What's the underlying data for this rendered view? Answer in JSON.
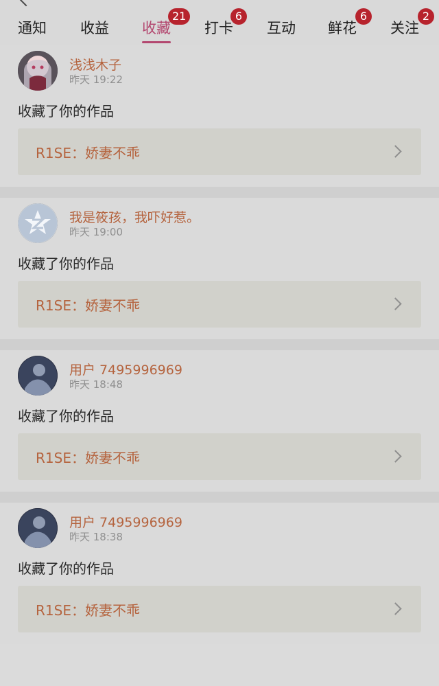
{
  "tabs": [
    {
      "label": "通知",
      "badge": ""
    },
    {
      "label": "收益",
      "badge": ""
    },
    {
      "label": "收藏",
      "badge": "21",
      "active": true
    },
    {
      "label": "打卡",
      "badge": "6"
    },
    {
      "label": "互动",
      "badge": ""
    },
    {
      "label": "鲜花",
      "badge": "6"
    },
    {
      "label": "关注",
      "badge": "2"
    }
  ],
  "feed": [
    {
      "username": "浅浅木子",
      "time": "昨天 19:22",
      "message": "收藏了你的作品",
      "work_title": "R1SE：娇妻不乖",
      "avatar_icon": "anime-girl-avatar"
    },
    {
      "username": "我是筱孩，我吓好惹。",
      "time": "昨天 19:00",
      "message": "收藏了你的作品",
      "work_title": "R1SE：娇妻不乖",
      "avatar_icon": "default-star-avatar"
    },
    {
      "username": "用户 7495996969",
      "time": "昨天 18:48",
      "message": "收藏了你的作品",
      "work_title": "R1SE：娇妻不乖",
      "avatar_icon": "blue-photo-avatar"
    },
    {
      "username": "用户 7495996969",
      "time": "昨天 18:38",
      "message": "收藏了你的作品",
      "work_title": "R1SE：娇妻不乖",
      "avatar_icon": "blue-photo-avatar"
    }
  ],
  "colors": {
    "accent": "#b3476f",
    "badge": "#b7232d",
    "link_text": "#b5643f"
  }
}
